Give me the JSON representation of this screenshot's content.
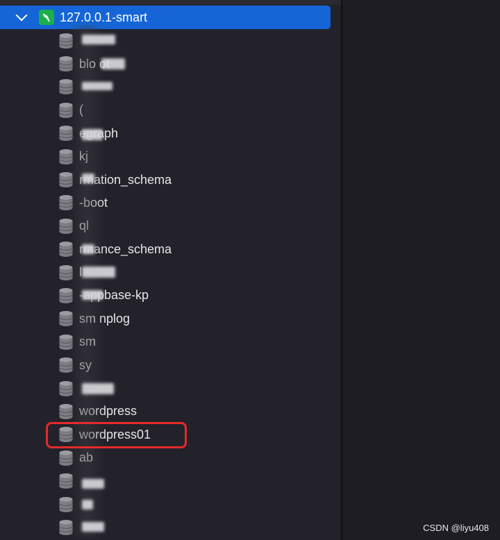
{
  "connection": {
    "label": "127.0.0.1-smart",
    "icon": "mysql-dolphin-icon",
    "expanded": true,
    "accent": "#1565d6"
  },
  "databases": [
    {
      "label": ""
    },
    {
      "label": "blo   ot"
    },
    {
      "label": ""
    },
    {
      "label": "("
    },
    {
      "label": "egraph"
    },
    {
      "label": "kj"
    },
    {
      "label": "rmation_schema"
    },
    {
      "label": "-boot"
    },
    {
      "label": "ql"
    },
    {
      "label": "rmance_schema"
    },
    {
      "label": "l"
    },
    {
      "label": "-appbase-kp"
    },
    {
      "label": "sm    nplog"
    },
    {
      "label": "sm"
    },
    {
      "label": "sy"
    },
    {
      "label": ""
    },
    {
      "label": "wordpress"
    },
    {
      "label": "wordpress01",
      "highlighted": true
    },
    {
      "label": "ab"
    },
    {
      "label": ""
    },
    {
      "label": ""
    },
    {
      "label": ""
    }
  ],
  "highlight_color": "#e32b2b",
  "watermark": "CSDN @liyu408"
}
